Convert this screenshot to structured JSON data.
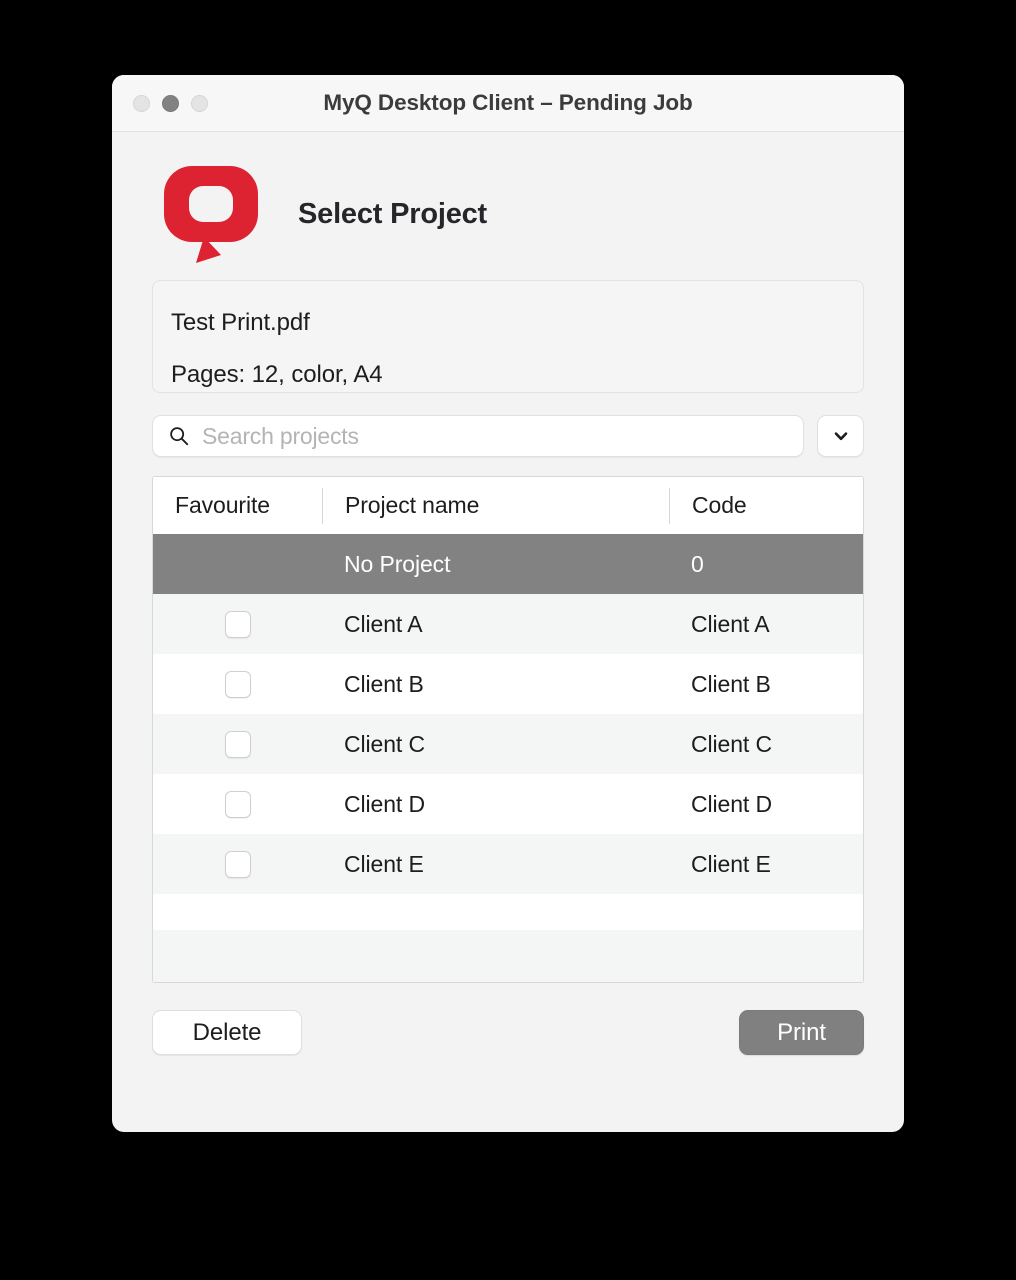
{
  "window": {
    "title": "MyQ Desktop Client – Pending Job",
    "traffic_lights": [
      "close",
      "minimize",
      "zoom"
    ]
  },
  "header": {
    "logo_name": "myq-logo",
    "logo_color": "#dd2231",
    "title": "Select Project"
  },
  "job": {
    "file_name": "Test Print.pdf",
    "details": "Pages: 12, color, A4"
  },
  "search": {
    "placeholder": "Search projects",
    "value": "",
    "icon": "search-icon",
    "dropdown_icon": "chevron-down-icon"
  },
  "table": {
    "columns": [
      "Favourite",
      "Project name",
      "Code"
    ],
    "rows": [
      {
        "favourite": false,
        "has_checkbox": false,
        "name": "No Project",
        "code": "0",
        "selected": true
      },
      {
        "favourite": false,
        "has_checkbox": true,
        "name": "Client A",
        "code": "Client A",
        "selected": false
      },
      {
        "favourite": false,
        "has_checkbox": true,
        "name": "Client B",
        "code": "Client B",
        "selected": false
      },
      {
        "favourite": false,
        "has_checkbox": true,
        "name": "Client C",
        "code": "Client C",
        "selected": false
      },
      {
        "favourite": false,
        "has_checkbox": true,
        "name": "Client D",
        "code": "Client D",
        "selected": false
      },
      {
        "favourite": false,
        "has_checkbox": true,
        "name": "Client E",
        "code": "Client E",
        "selected": false
      }
    ],
    "selected_row_color": "#828282"
  },
  "footer": {
    "delete_label": "Delete",
    "print_label": "Print",
    "print_color": "#808080"
  }
}
